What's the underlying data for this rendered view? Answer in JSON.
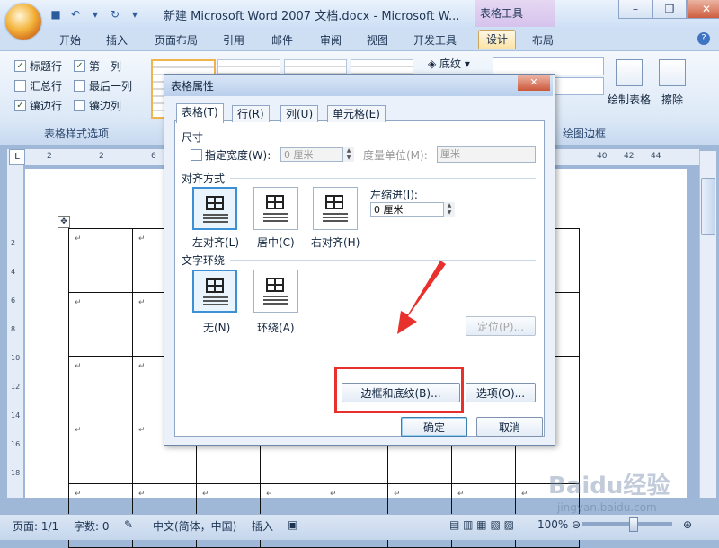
{
  "window": {
    "title": "新建 Microsoft Word 2007 文档.docx - Microsoft W...",
    "context_tools": "表格工具",
    "minimize": "–",
    "restore": "❐",
    "close": "✕"
  },
  "tabs": [
    "开始",
    "插入",
    "页面布局",
    "引用",
    "邮件",
    "审阅",
    "视图",
    "开发工具",
    "设计",
    "布局"
  ],
  "active_tab": "设计",
  "ribbon": {
    "checkboxes": [
      {
        "label": "标题行",
        "checked": "✓"
      },
      {
        "label": "第一列",
        "checked": "✓"
      },
      {
        "label": "汇总行",
        "checked": ""
      },
      {
        "label": "最后一列",
        "checked": ""
      },
      {
        "label": "镶边行",
        "checked": "✓"
      },
      {
        "label": "镶边列",
        "checked": ""
      }
    ],
    "group_style_options": "表格样式选项",
    "shading": "底纹",
    "draw_table": "绘制表格",
    "eraser": "擦除",
    "group_borders": "绘图边框"
  },
  "ruler": [
    "2",
    "2",
    "6",
    "40",
    "42",
    "44"
  ],
  "vruler": [
    "2",
    "4",
    "6",
    "8",
    "10",
    "12",
    "14",
    "16",
    "18"
  ],
  "dialog": {
    "title": "表格属性",
    "close": "✕",
    "tabs": [
      "表格(T)",
      "行(R)",
      "列(U)",
      "单元格(E)"
    ],
    "size_label": "尺寸",
    "preferred_width": "指定宽度(W):",
    "width_value": "0 厘米",
    "measure_label": "度量单位(M):",
    "measure_value": "厘米",
    "alignment_label": "对齐方式",
    "align_left": "左对齐(L)",
    "align_center": "居中(C)",
    "align_right": "右对齐(H)",
    "indent_label": "左缩进(I):",
    "indent_value": "0 厘米",
    "wrap_label": "文字环绕",
    "wrap_none": "无(N)",
    "wrap_around": "环绕(A)",
    "positioning": "定位(P)...",
    "borders_shading": "边框和底纹(B)...",
    "options": "选项(O)...",
    "ok": "确定",
    "cancel": "取消"
  },
  "status": {
    "page": "页面: 1/1",
    "words": "字数: 0",
    "language": "中文(简体，中国)",
    "insert": "插入",
    "zoom": "100%"
  },
  "watermark": "Baidu经验",
  "watermark_url": "jingyan.baidu.com",
  "colors": {
    "highlight": "#e8302c",
    "accent": "#3d8fd6"
  }
}
